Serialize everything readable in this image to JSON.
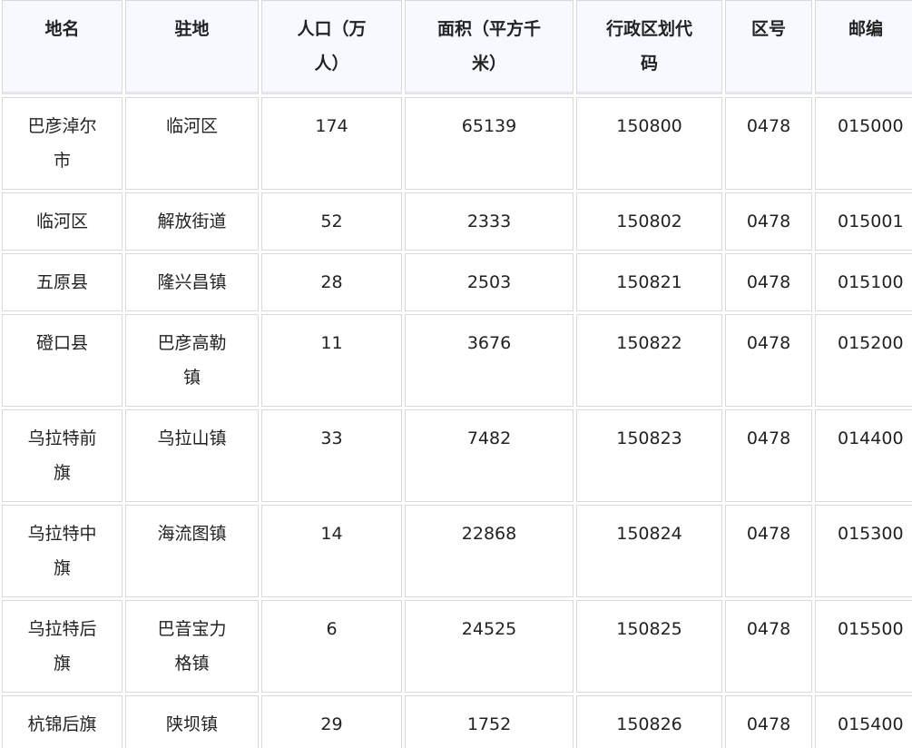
{
  "table": {
    "headers": [
      "地名",
      "驻地",
      "人口（万人）",
      "面积（平方千米）",
      "行政区划代码",
      "区号",
      "邮编"
    ],
    "rows": [
      [
        "巴彦淖尔市",
        "临河区",
        "174",
        "65139",
        "150800",
        "0478",
        "015000"
      ],
      [
        "临河区",
        "解放街道",
        "52",
        "2333",
        "150802",
        "0478",
        "015001"
      ],
      [
        "五原县",
        "隆兴昌镇",
        "28",
        "2503",
        "150821",
        "0478",
        "015100"
      ],
      [
        "磴口县",
        "巴彦高勒镇",
        "11",
        "3676",
        "150822",
        "0478",
        "015200"
      ],
      [
        "乌拉特前旗",
        "乌拉山镇",
        "33",
        "7482",
        "150823",
        "0478",
        "014400"
      ],
      [
        "乌拉特中旗",
        "海流图镇",
        "14",
        "22868",
        "150824",
        "0478",
        "015300"
      ],
      [
        "乌拉特后旗",
        "巴音宝力格镇",
        "6",
        "24525",
        "150825",
        "0478",
        "015500"
      ],
      [
        "杭锦后旗",
        "陕坝镇",
        "29",
        "1752",
        "150826",
        "0478",
        "015400"
      ]
    ]
  },
  "colors": {
    "header_bg": "#f6f9ff",
    "border": "#d9d9d9",
    "text": "#222222"
  }
}
